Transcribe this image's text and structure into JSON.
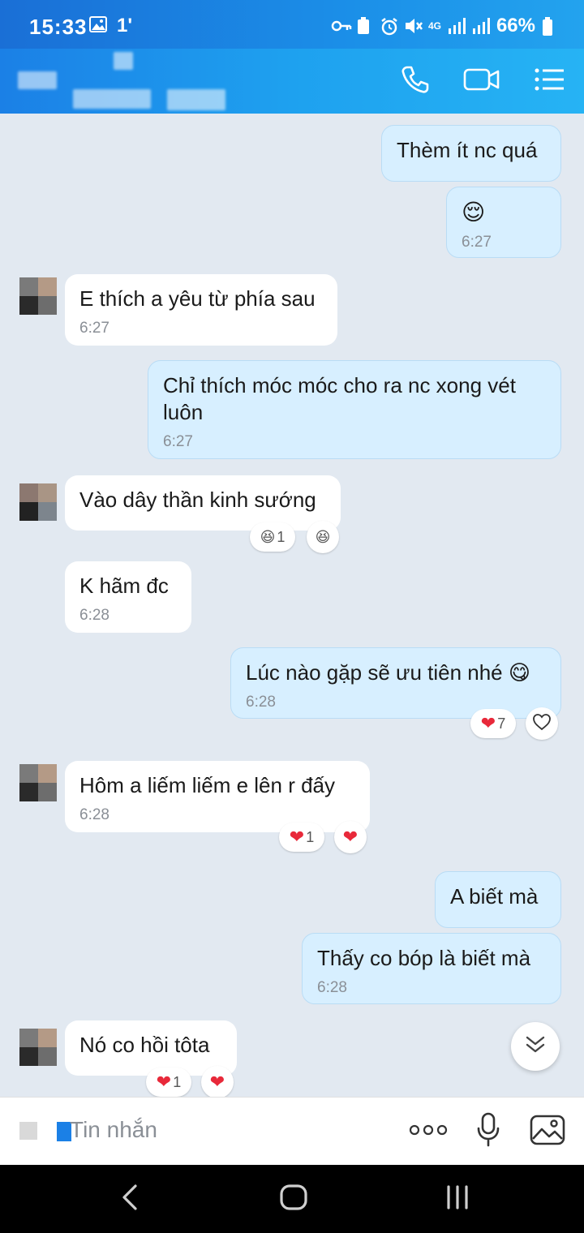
{
  "status_bar": {
    "time": "15:33",
    "extra": "1'",
    "network": "4G",
    "battery": "66%"
  },
  "header": {
    "contact_name_blurred": true,
    "icons": [
      "phone-icon",
      "video-icon",
      "menu-icon"
    ]
  },
  "messages": [
    {
      "dir": "out",
      "text": "Thèm ít nc quá",
      "time": ""
    },
    {
      "dir": "out",
      "text": "😌",
      "time": "6:27"
    },
    {
      "dir": "in",
      "text": "E thích a yêu từ phía sau",
      "time": "6:27"
    },
    {
      "dir": "out",
      "text": "Chỉ thích móc móc cho ra nc xong vét luôn",
      "time": "6:27"
    },
    {
      "dir": "in",
      "text": "Vào dây thần kinh sướng",
      "time": "",
      "reaction": {
        "emoji": "😆",
        "count": "1"
      }
    },
    {
      "dir": "in",
      "text": "K hãm đc",
      "time": "6:28"
    },
    {
      "dir": "out",
      "text": "Lúc nào gặp sẽ ưu tiên nhé 😋",
      "time": "6:28",
      "reaction": {
        "emoji": "❤",
        "count": "7"
      }
    },
    {
      "dir": "in",
      "text": "Hôm a liếm liếm e lên r đấy",
      "time": "6:28",
      "reaction": {
        "emoji": "❤",
        "count": "1"
      }
    },
    {
      "dir": "out",
      "text": "A biết mà",
      "time": ""
    },
    {
      "dir": "out",
      "text": "Thấy co bóp là biết mà",
      "time": "6:28"
    },
    {
      "dir": "in",
      "text": "Nó co hồi tôta",
      "time": "",
      "reaction": {
        "emoji": "❤",
        "count": "1"
      }
    }
  ],
  "input": {
    "placeholder": "Tin nhắn",
    "more_label": "ooo"
  },
  "colors": {
    "header_start": "#1b80e6",
    "header_end": "#26b3f4",
    "chat_bg": "#e2e9f1",
    "outgoing_bubble": "#d7efff",
    "incoming_bubble": "#ffffff",
    "heart": "#e8293a"
  }
}
